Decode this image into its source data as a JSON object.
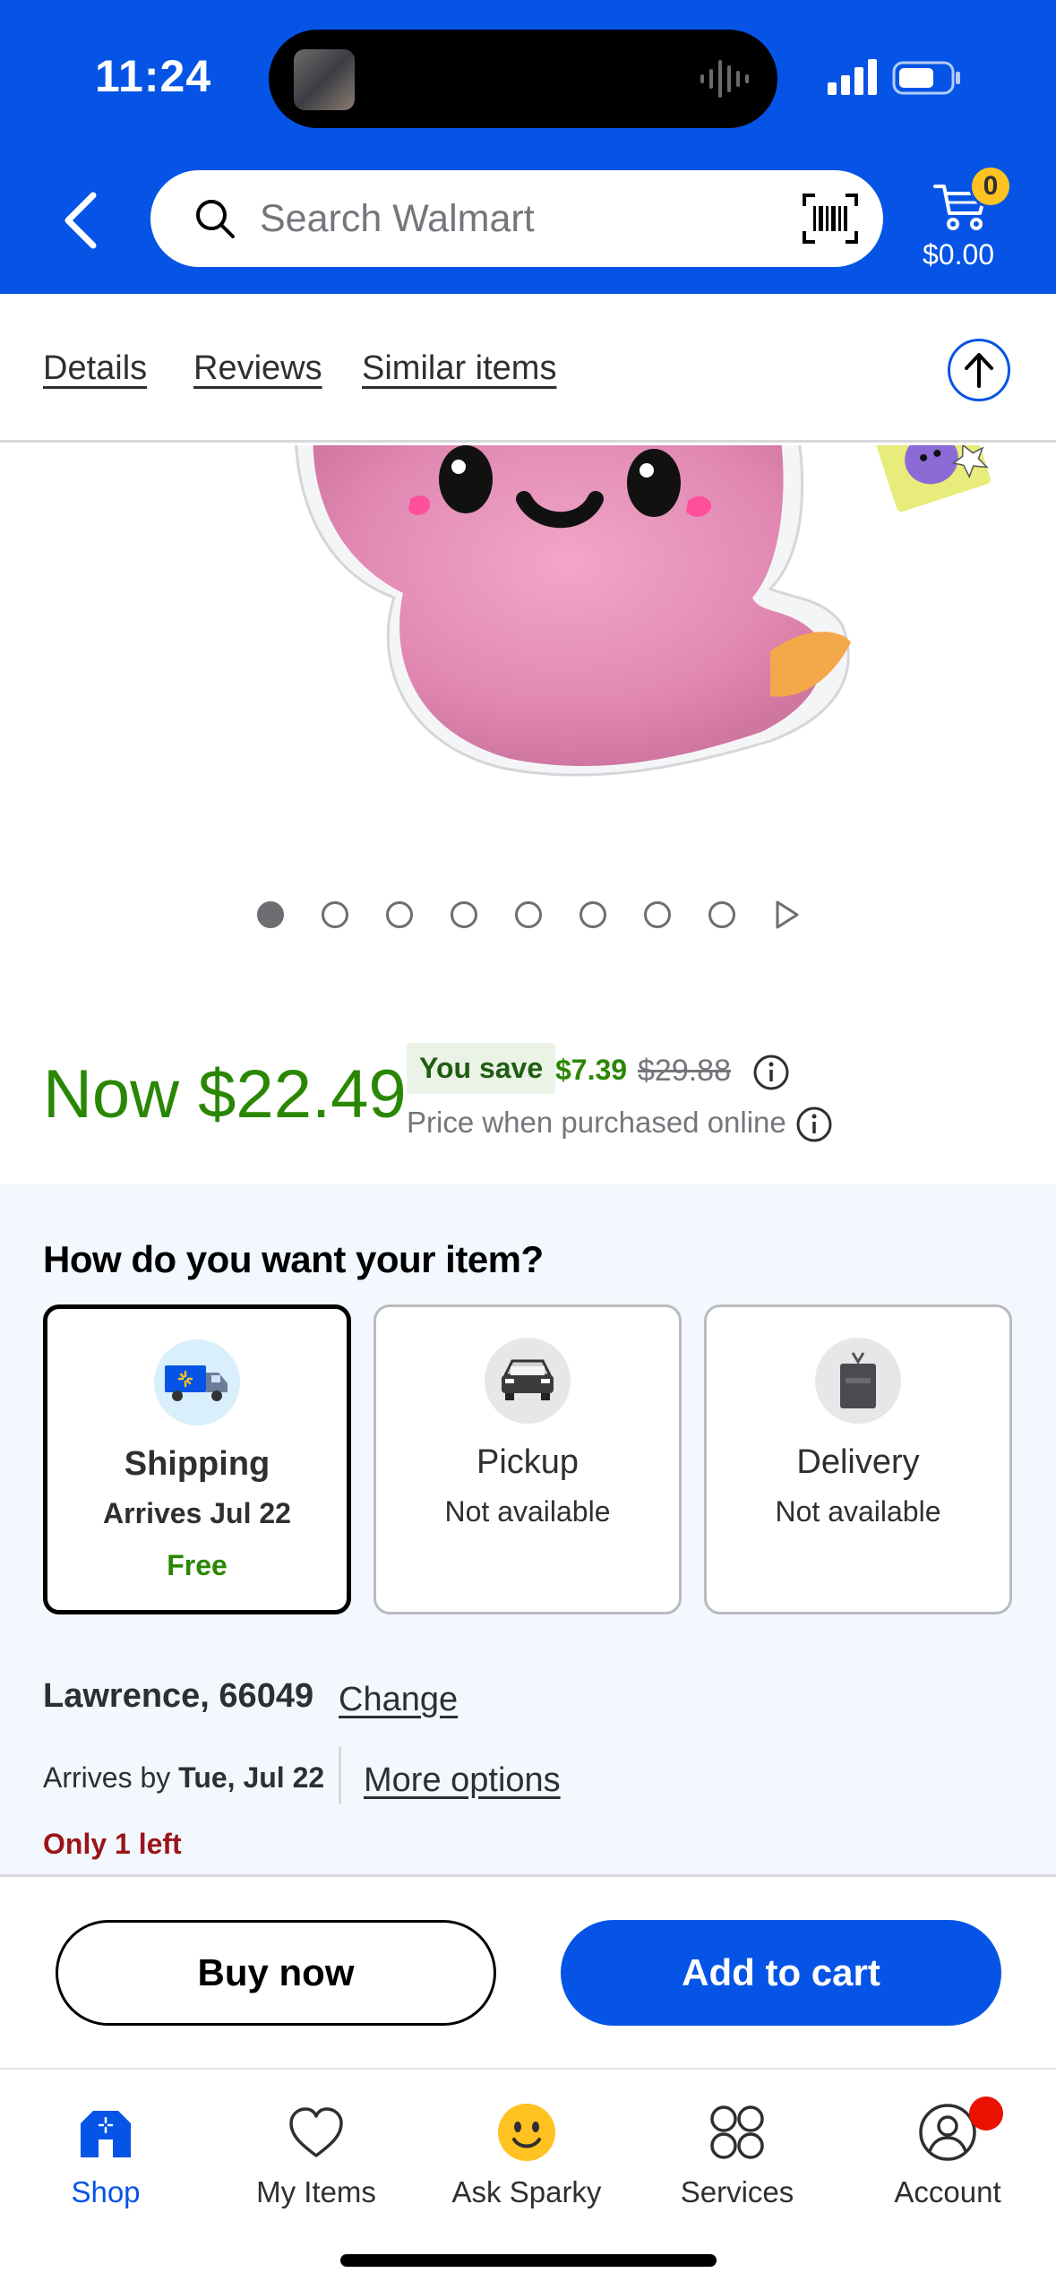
{
  "status_bar": {
    "time": "11:24"
  },
  "header": {
    "search_placeholder": "Search Walmart",
    "cart_count": "0",
    "cart_total": "$0.00"
  },
  "section_tabs": [
    {
      "label": "Details"
    },
    {
      "label": "Reviews"
    },
    {
      "label": "Similar items"
    }
  ],
  "carousel": {
    "total": 8,
    "active_index": 0
  },
  "price": {
    "now": "Now $22.49",
    "you_save_label": "You save",
    "save_amount": "$7.39",
    "was": "$29.88",
    "note": "Price when purchased online"
  },
  "fulfillment": {
    "title": "How do you want your item?",
    "options": [
      {
        "title": "Shipping",
        "subtitle": "Arrives Jul 22",
        "price": "Free",
        "icon": "shipping-truck-icon"
      },
      {
        "title": "Pickup",
        "subtitle": "Not available",
        "icon": "pickup-car-icon"
      },
      {
        "title": "Delivery",
        "subtitle": "Not available",
        "icon": "delivery-bag-icon"
      }
    ],
    "location": "Lawrence, 66049",
    "change_label": "Change",
    "arrives_prefix": "Arrives by",
    "arrives_date": "Tue, Jul 22",
    "more_options": "More options",
    "stock": "Only 1 left"
  },
  "cta": {
    "buy_now": "Buy now",
    "add_to_cart": "Add to cart"
  },
  "bottom_nav": [
    {
      "label": "Shop",
      "icon": "shop-icon"
    },
    {
      "label": "My Items",
      "icon": "heart-icon"
    },
    {
      "label": "Ask Sparky",
      "icon": "sparky-icon"
    },
    {
      "label": "Services",
      "icon": "services-grid-icon"
    },
    {
      "label": "Account",
      "icon": "account-icon"
    }
  ],
  "colors": {
    "brand_blue": "#0654e6",
    "price_green": "#2a8703",
    "stock_red": "#9b1419",
    "badge_yellow": "#ffc220"
  }
}
